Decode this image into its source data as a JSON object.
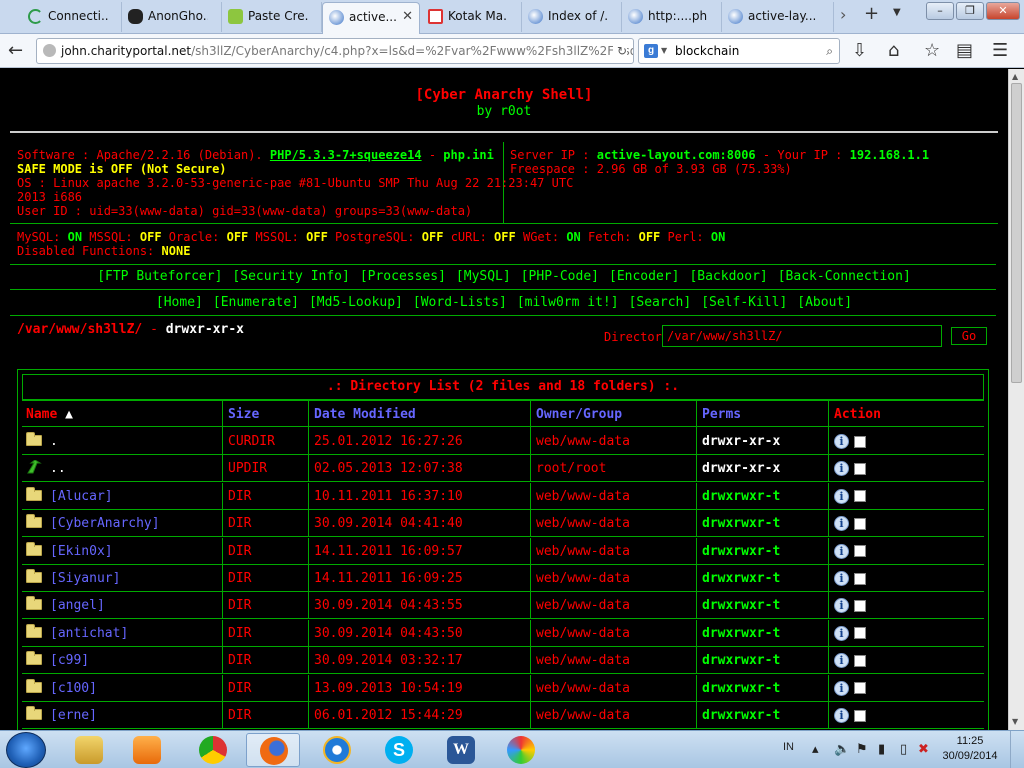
{
  "browser": {
    "tabs": [
      {
        "label": "Connecti...",
        "icon": "spinner-icon",
        "active": false
      },
      {
        "label": "AnonGho...",
        "icon": "bug-icon",
        "active": false
      },
      {
        "label": "Paste Cre...",
        "icon": "pastebin-icon",
        "active": false
      },
      {
        "label": "active...",
        "icon": "globe-icon",
        "active": true
      },
      {
        "label": "Kotak Ma...",
        "icon": "gmail-icon",
        "active": false
      },
      {
        "label": "Index of /...",
        "icon": "globe-icon",
        "active": false
      },
      {
        "label": "http:....php",
        "icon": "globe-icon",
        "active": false
      },
      {
        "label": "active-lay...",
        "icon": "globe-icon",
        "active": false
      }
    ],
    "url_host": "john.charityportal.net",
    "url_path": "/sh3llZ/CyberAnarchy/c4.php?x=ls&d=%2Fvar%2Fwww%2Fsh3llZ%2F&sort=0a",
    "search_text": "blockchain"
  },
  "shell": {
    "title": "[Cyber Anarchy Shell]",
    "byline": "by r0ot",
    "software_label": "Software : Apache/2.2.16 (Debian).",
    "php_version": "PHP/5.3.3-7+squeeze14",
    "sep": "-",
    "php_ini": "php.ini",
    "safe_mode": "SAFE MODE is OFF (Not Secure)",
    "os_line1": "OS : Linux apache 3.2.0-53-generic-pae #81-Ubuntu SMP Thu Aug 22 21:23:47 UTC",
    "os_line2": "2013 i686",
    "user_id": "User ID : uid=33(www-data) gid=33(www-data) groups=33(www-data)",
    "server_ip_label": "Server IP :",
    "server_ip": "active-layout.com:8006",
    "your_ip_label": "- Your IP :",
    "your_ip": "192.168.1.1",
    "freespace": "Freespace : 2.96 GB of 3.93 GB (75.33%)",
    "modules": [
      {
        "name": "MySQL:",
        "status": "ON"
      },
      {
        "name": "MSSQL:",
        "status": "OFF"
      },
      {
        "name": "Oracle:",
        "status": "OFF"
      },
      {
        "name": "MSSQL:",
        "status": "OFF"
      },
      {
        "name": "PostgreSQL:",
        "status": "OFF"
      },
      {
        "name": "cURL:",
        "status": "OFF"
      },
      {
        "name": "WGet:",
        "status": "ON"
      },
      {
        "name": "Fetch:",
        "status": "OFF"
      },
      {
        "name": "Perl:",
        "status": "ON"
      }
    ],
    "disabled_label": "Disabled Functions:",
    "disabled_value": "NONE",
    "menu1": [
      "[FTP Buteforcer]",
      "[Security Info]",
      "[Processes]",
      "[MySQL]",
      "[PHP-Code]",
      "[Encoder]",
      "[Backdoor]",
      "[Back-Connection]"
    ],
    "menu2": [
      "[Home]",
      "[Enumerate]",
      "[Md5-Lookup]",
      "[Word-Lists]",
      "[milw0rm it!]",
      "[Search]",
      "[Self-Kill]",
      "[About]"
    ],
    "cwd": "/var/www/sh3llZ/",
    "cwd_sep": "-",
    "cwd_perms": "drwxr-xr-x",
    "directory_label": "Directory:",
    "directory_value": "/var/www/sh3llZ/",
    "go_label": "Go"
  },
  "listing": {
    "caption": ".: Directory List (2 files and 18 folders) :.",
    "headers": {
      "name": "Name",
      "sort_arrow": "▲",
      "size": "Size",
      "date": "Date Modified",
      "owner": "Owner/Group",
      "perms": "Perms",
      "action": "Action"
    },
    "rows": [
      {
        "name": ".",
        "icon": "folder",
        "size": "CURDIR",
        "date": "25.01.2012 16:27:26",
        "owner": "web/www-data",
        "perms": "drwxr-xr-x"
      },
      {
        "name": "..",
        "icon": "updir",
        "size": "UPDIR",
        "date": "02.05.2013 12:07:38",
        "owner": "root/root",
        "perms": "drwxr-xr-x"
      },
      {
        "name": "[Alucar]",
        "icon": "folder",
        "size": "DIR",
        "date": "10.11.2011 16:37:10",
        "owner": "web/www-data",
        "perms": "drwxrwxr-t"
      },
      {
        "name": "[CyberAnarchy]",
        "icon": "folder",
        "size": "DIR",
        "date": "30.09.2014 04:41:40",
        "owner": "web/www-data",
        "perms": "drwxrwxr-t"
      },
      {
        "name": "[Ekin0x]",
        "icon": "folder",
        "size": "DIR",
        "date": "14.11.2011 16:09:57",
        "owner": "web/www-data",
        "perms": "drwxrwxr-t"
      },
      {
        "name": "[Siyanur]",
        "icon": "folder",
        "size": "DIR",
        "date": "14.11.2011 16:09:25",
        "owner": "web/www-data",
        "perms": "drwxrwxr-t"
      },
      {
        "name": "[angel]",
        "icon": "folder",
        "size": "DIR",
        "date": "30.09.2014 04:43:55",
        "owner": "web/www-data",
        "perms": "drwxrwxr-t"
      },
      {
        "name": "[antichat]",
        "icon": "folder",
        "size": "DIR",
        "date": "30.09.2014 04:43:50",
        "owner": "web/www-data",
        "perms": "drwxrwxr-t"
      },
      {
        "name": "[c99]",
        "icon": "folder",
        "size": "DIR",
        "date": "30.09.2014 03:32:17",
        "owner": "web/www-data",
        "perms": "drwxrwxr-t"
      },
      {
        "name": "[c100]",
        "icon": "folder",
        "size": "DIR",
        "date": "13.09.2013 10:54:19",
        "owner": "web/www-data",
        "perms": "drwxrwxr-t"
      },
      {
        "name": "[erne]",
        "icon": "folder",
        "size": "DIR",
        "date": "06.01.2012 15:44:29",
        "owner": "web/www-data",
        "perms": "drwxrwxr-t"
      }
    ]
  },
  "taskbar": {
    "apps": [
      "explorer-icon",
      "media-player-icon",
      "chrome-icon",
      "firefox-icon",
      "ie-icon",
      "skype-icon",
      "word-icon",
      "paint-icon"
    ],
    "lang": "IN",
    "time": "11:25",
    "date": "30/09/2014"
  },
  "colors": {
    "on": "#00ff00",
    "off": "#ffff00",
    "label": "#ff0000",
    "link": "#6666ff",
    "border": "#00aa00"
  }
}
